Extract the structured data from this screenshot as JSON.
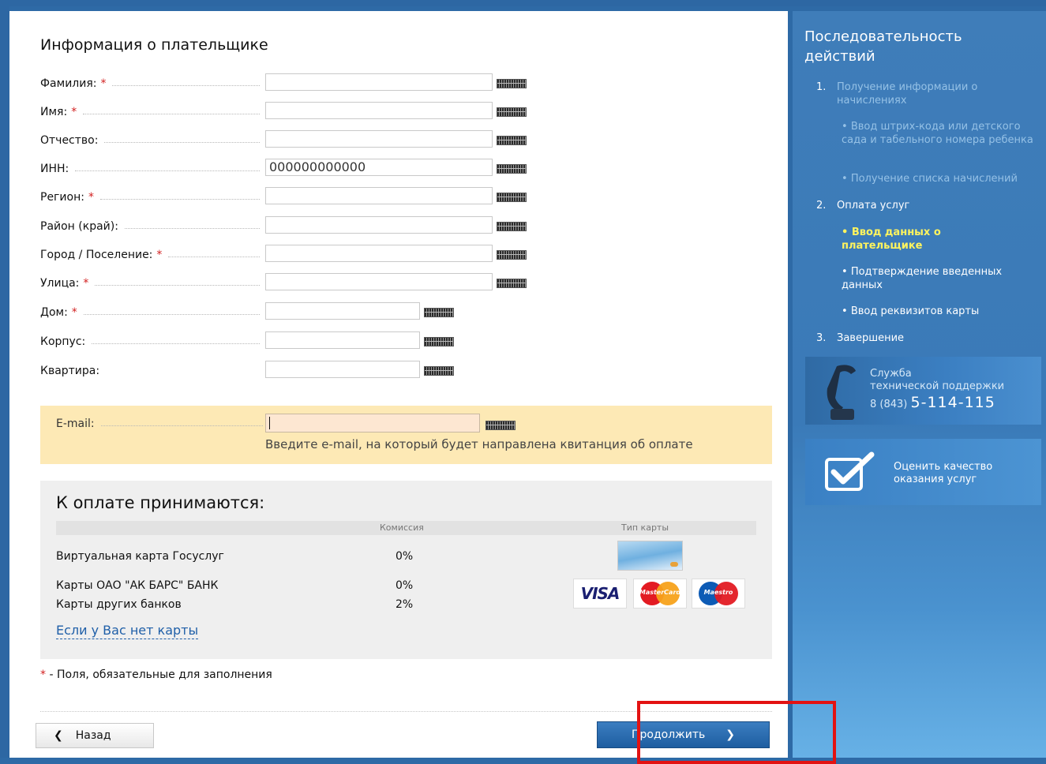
{
  "form": {
    "title": "Информация о плательщике",
    "required_mark": "*",
    "fields": [
      {
        "label": "Фамилия:",
        "required": true,
        "value": ""
      },
      {
        "label": "Имя:",
        "required": true,
        "value": ""
      },
      {
        "label": "Отчество:",
        "required": false,
        "value": ""
      },
      {
        "label": "ИНН:",
        "required": false,
        "value": "000000000000"
      },
      {
        "label": "Регион:",
        "required": true,
        "value": ""
      },
      {
        "label": "Район (край):",
        "required": false,
        "value": ""
      },
      {
        "label": "Город / Поселение:",
        "required": true,
        "value": ""
      },
      {
        "label": "Улица:",
        "required": true,
        "value": ""
      },
      {
        "label": "Дом:",
        "required": true,
        "value": ""
      },
      {
        "label": "Корпус:",
        "required": false,
        "value": ""
      },
      {
        "label": "Квартира:",
        "required": false,
        "value": ""
      }
    ],
    "email": {
      "label": "E-mail:",
      "value": "",
      "hint": "Введите e-mail, на который будет направлена квитанция об оплате"
    }
  },
  "payment": {
    "title": "К оплате принимаются:",
    "col_commission": "Комиссия",
    "col_card_type": "Тип карты",
    "rows": [
      {
        "name": "Виртуальная карта Госуслуг",
        "commission": "0%"
      },
      {
        "name": "Карты ОАО \"АК БАРС\" БАНК",
        "commission": "0%"
      },
      {
        "name": "Карты других банков",
        "commission": "2%"
      }
    ],
    "cards": {
      "visa": "VISA",
      "mastercard": "MasterCard",
      "maestro": "Maestro"
    },
    "no_card_link": "Если у Вас нет карты"
  },
  "required_note": {
    "star": "*",
    "text": " - Поля, обязательные для заполнения"
  },
  "buttons": {
    "back": "Назад",
    "next": "Продолжить"
  },
  "sidebar": {
    "title_line1": "Последовательность",
    "title_line2": "действий",
    "step1_num": "1.",
    "step1_label": "Получение информации о начислениях",
    "step1_sub1": "Ввод штрих-кода или детского сада и табельного номера ребенка",
    "step1_sub2": "Получение списка начислений",
    "step2_num": "2.",
    "step2_label": "Оплата услуг",
    "step2_sub1": "Ввод данных о плательщике",
    "step2_sub2": "Подтверждение введенных данных",
    "step2_sub3": "Ввод реквизитов карты",
    "step3_num": "3.",
    "step3_label": "Завершение",
    "support_line1": "Служба",
    "support_line2": "технической поддержки",
    "support_prefix": "8 (843)",
    "support_number": "5-114-115",
    "quality_line1": "Оценить качество",
    "quality_line2": "оказания услуг"
  },
  "colors": {
    "accent": "#2e6aa6",
    "required": "#d21f1f",
    "email_bg": "#fde9b5",
    "highlight": "#e31212",
    "active_step": "#fff45e"
  }
}
